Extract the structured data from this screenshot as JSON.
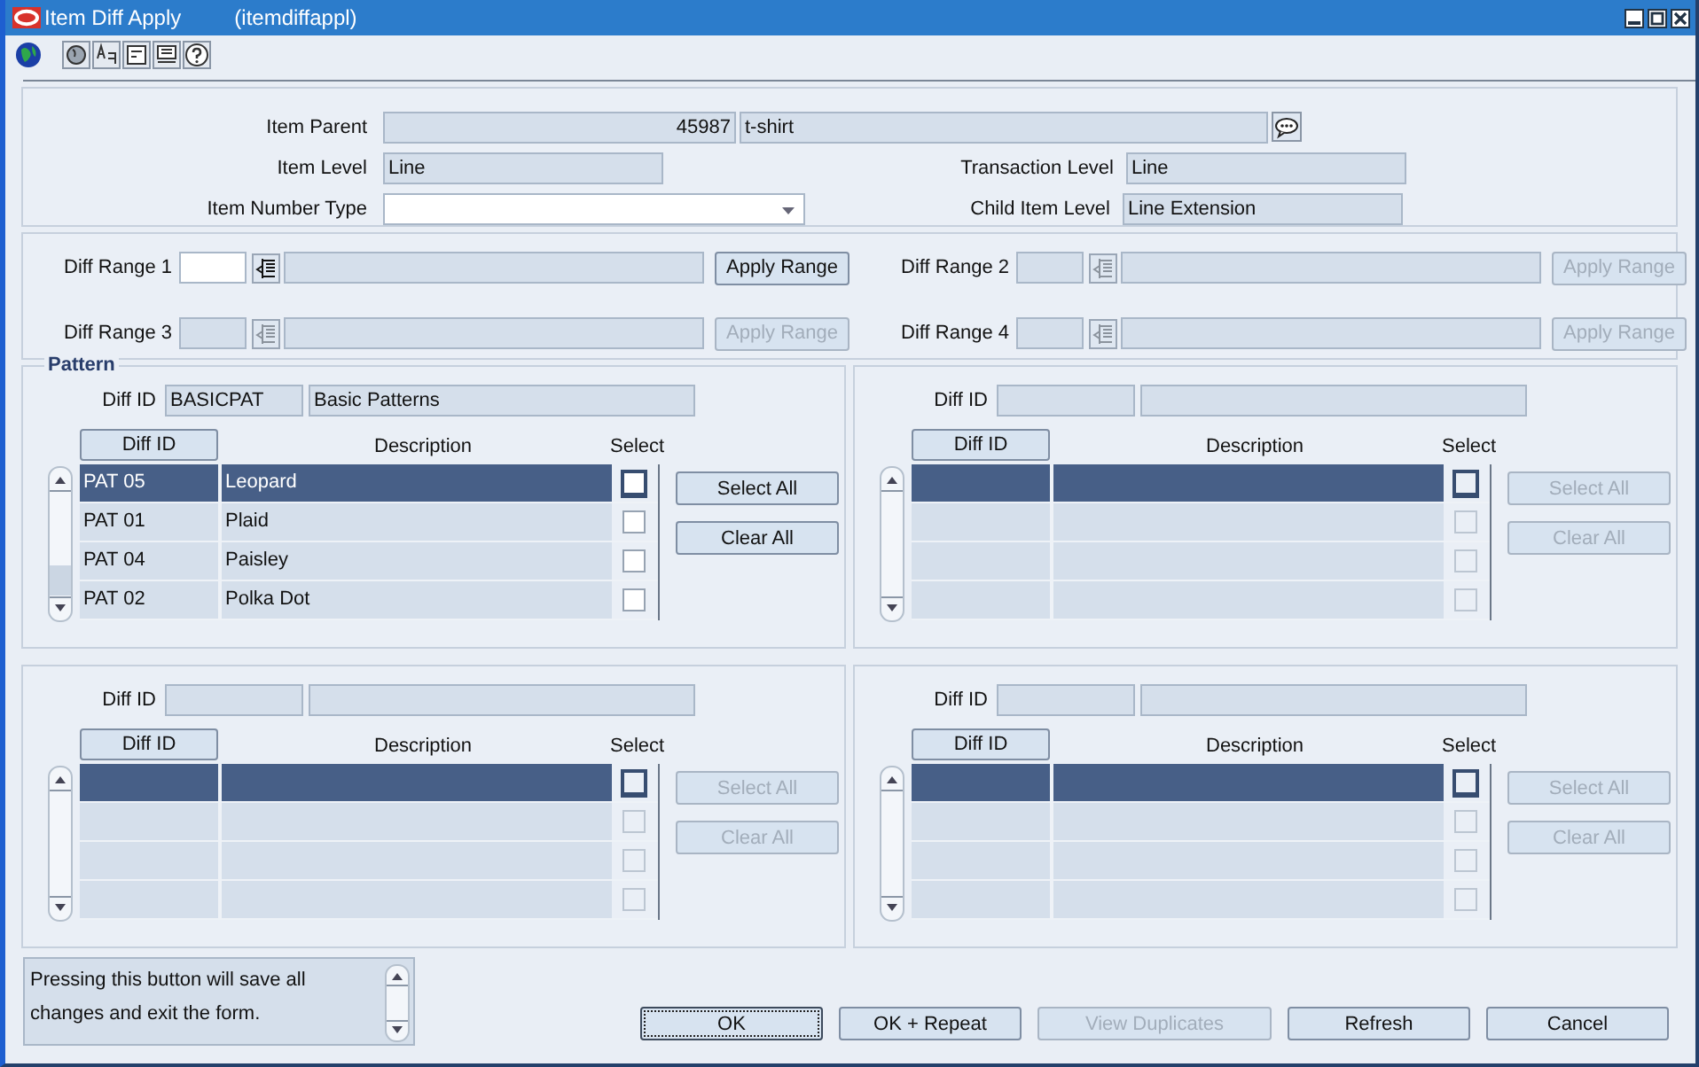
{
  "window": {
    "title": "Item Diff Apply",
    "form_name": "(itemdiffappl)"
  },
  "header": {
    "item_parent": {
      "label": "Item Parent",
      "number": "45987",
      "description": "t-shirt"
    },
    "item_level": {
      "label": "Item Level",
      "value": "Line"
    },
    "transaction_level": {
      "label": "Transaction Level",
      "value": "Line"
    },
    "item_number_type": {
      "label": "Item Number Type"
    },
    "child_item_level": {
      "label": "Child Item Level",
      "value": "Line Extension"
    }
  },
  "diff_ranges": [
    {
      "label": "Diff Range 1",
      "enabled": true,
      "button": "Apply Range"
    },
    {
      "label": "Diff Range 2",
      "enabled": false,
      "button": "Apply Range"
    },
    {
      "label": "Diff Range 3",
      "enabled": false,
      "button": "Apply Range"
    },
    {
      "label": "Diff Range 4",
      "enabled": false,
      "button": "Apply Range"
    }
  ],
  "panels": [
    {
      "title": "Pattern",
      "label": "Diff ID",
      "diff_id": "BASICPAT",
      "description": "Basic Patterns",
      "enabled": true,
      "columns": [
        "Diff ID",
        "Description",
        "Select"
      ],
      "buttons": [
        "Select All",
        "Clear All"
      ],
      "rows": [
        {
          "diff_id": "PAT 05",
          "description": "Leopard",
          "selected": true,
          "checked": false
        },
        {
          "diff_id": "PAT 01",
          "description": "Plaid",
          "selected": false,
          "checked": false
        },
        {
          "diff_id": "PAT 04",
          "description": "Paisley",
          "selected": false,
          "checked": false
        },
        {
          "diff_id": "PAT 02",
          "description": "Polka Dot",
          "selected": false,
          "checked": false
        }
      ]
    },
    {
      "label": "Diff ID",
      "enabled": false,
      "columns": [
        "Diff ID",
        "Description",
        "Select"
      ],
      "buttons": [
        "Select All",
        "Clear All"
      ],
      "rows": [
        {
          "selected": true,
          "checked": false
        },
        {
          "selected": false,
          "checked": false
        },
        {
          "selected": false,
          "checked": false
        },
        {
          "selected": false,
          "checked": false
        }
      ]
    },
    {
      "label": "Diff ID",
      "enabled": false,
      "columns": [
        "Diff ID",
        "Description",
        "Select"
      ],
      "buttons": [
        "Select All",
        "Clear All"
      ],
      "rows": [
        {
          "selected": true,
          "checked": false
        },
        {
          "selected": false,
          "checked": false
        },
        {
          "selected": false,
          "checked": false
        },
        {
          "selected": false,
          "checked": false
        }
      ]
    },
    {
      "label": "Diff ID",
      "enabled": false,
      "columns": [
        "Diff ID",
        "Description",
        "Select"
      ],
      "buttons": [
        "Select All",
        "Clear All"
      ],
      "rows": [
        {
          "selected": true,
          "checked": false
        },
        {
          "selected": false,
          "checked": false
        },
        {
          "selected": false,
          "checked": false
        },
        {
          "selected": false,
          "checked": false
        }
      ]
    }
  ],
  "hint": "Pressing this button will save all changes and exit the form.",
  "buttons": [
    {
      "label": "OK",
      "disabled": false,
      "focused": true
    },
    {
      "label": "OK + Repeat",
      "disabled": false,
      "focused": false
    },
    {
      "label": "View Duplicates",
      "disabled": true,
      "focused": false
    },
    {
      "label": "Refresh",
      "disabled": false,
      "focused": false
    },
    {
      "label": "Cancel",
      "disabled": false,
      "focused": false
    }
  ]
}
